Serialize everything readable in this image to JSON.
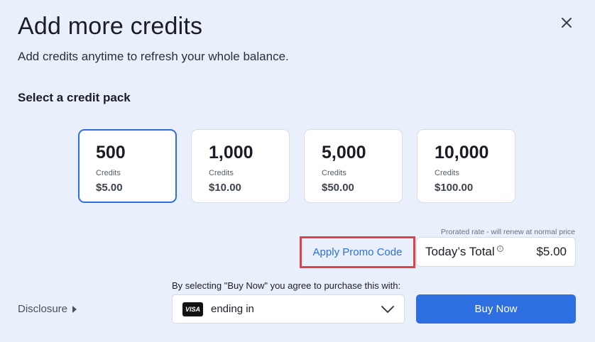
{
  "header": {
    "title": "Add more credits",
    "subtitle": "Add credits anytime to refresh your whole balance."
  },
  "section_title": "Select a credit pack",
  "packs": [
    {
      "amount": "500",
      "unit": "Credits",
      "price": "$5.00",
      "selected": true
    },
    {
      "amount": "1,000",
      "unit": "Credits",
      "price": "$10.00",
      "selected": false
    },
    {
      "amount": "5,000",
      "unit": "Credits",
      "price": "$50.00",
      "selected": false
    },
    {
      "amount": "10,000",
      "unit": "Credits",
      "price": "$100.00",
      "selected": false
    }
  ],
  "prorated_note": "Prorated rate - will renew at normal price",
  "promo_label": "Apply Promo Code",
  "total": {
    "label": "Today’s Total",
    "amount": "$5.00"
  },
  "agree_text": "By selecting \"Buy Now\" you agree to purchase this with:",
  "disclosure_label": "Disclosure",
  "payment": {
    "card_brand": "VISA",
    "text": "ending in"
  },
  "buy_label": "Buy Now",
  "icons": {
    "close": "close-icon",
    "info": "info-icon",
    "disclosure_arrow": "caret-right-icon",
    "dropdown": "chevron-down-icon",
    "card": "visa-card-icon"
  },
  "colors": {
    "accent": "#2d6fe0",
    "highlight_border": "#e14248",
    "background": "#eaf0fb"
  }
}
